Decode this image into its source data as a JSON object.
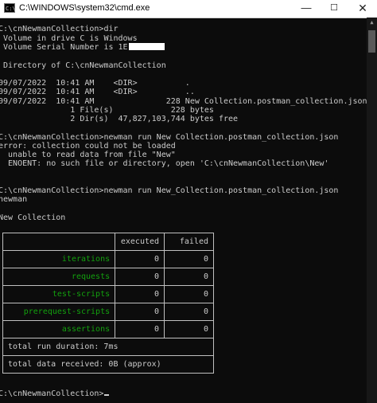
{
  "window": {
    "title": "C:\\WINDOWS\\system32\\cmd.exe",
    "minimize": "—",
    "maximize": "☐",
    "close": "✕"
  },
  "console": {
    "lines": [
      "C:\\cnNewmanCollection>dir",
      " Volume in drive C is Windows",
      " Volume Serial Number is 1E",
      " Directory of C:\\cnNewmanCollection",
      "09/07/2022  10:41 AM    <DIR>          .",
      "09/07/2022  10:41 AM    <DIR>          ..",
      "09/07/2022  10:41 AM               228 New Collection.postman_collection.json",
      "               1 File(s)            228 bytes",
      "               2 Dir(s)  47,827,103,744 bytes free",
      "C:\\cnNewmanCollection>newman run New Collection.postman_collection.json",
      "error: collection could not be loaded",
      "  unable to read data from file \"New\"",
      "  ENOENT: no such file or directory, open 'C:\\cnNewmanCollection\\New'",
      "C:\\cnNewmanCollection>newman run New_Collection.postman_collection.json",
      "newman",
      "New Collection"
    ],
    "prompt": "C:\\cnNewmanCollection>"
  },
  "summary": {
    "headers": [
      "executed",
      "failed"
    ],
    "rows": [
      {
        "label": "iterations",
        "executed": "0",
        "failed": "0"
      },
      {
        "label": "requests",
        "executed": "0",
        "failed": "0"
      },
      {
        "label": "test-scripts",
        "executed": "0",
        "failed": "0"
      },
      {
        "label": "prerequest-scripts",
        "executed": "0",
        "failed": "0"
      },
      {
        "label": "assertions",
        "executed": "0",
        "failed": "0"
      }
    ],
    "duration": "total run duration: 7ms",
    "data_received": "total data received: 0B (approx)"
  },
  "colors": {
    "background": "#0c0c0c",
    "text": "#cccccc",
    "label_green": "#13a10e"
  }
}
